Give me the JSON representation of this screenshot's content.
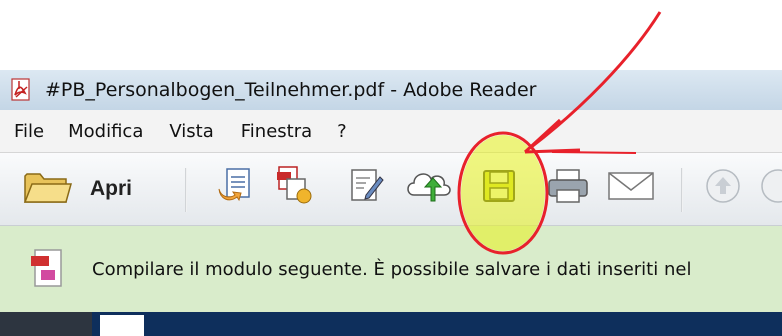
{
  "window": {
    "title": "#PB_Personalbogen_Teilnehmer.pdf - Adobe Reader"
  },
  "menu": {
    "items": [
      "File",
      "Modifica",
      "Vista",
      "Finestra",
      "?"
    ]
  },
  "toolbar": {
    "open_label": "Apri",
    "buttons": [
      {
        "name": "open-folder-icon"
      },
      {
        "name": "export-document-icon"
      },
      {
        "name": "create-pdf-icon"
      },
      {
        "name": "edit-document-icon"
      },
      {
        "name": "upload-cloud-icon"
      },
      {
        "name": "save-icon"
      },
      {
        "name": "print-icon"
      },
      {
        "name": "email-icon"
      },
      {
        "name": "page-up-icon"
      }
    ]
  },
  "infobar": {
    "message": "Compilare il modulo seguente. È possibile salvare i dati inseriti nel"
  },
  "colors": {
    "annotation_red": "#e8212b",
    "highlight_yellow": "#e8f21a",
    "infobar_green": "#d9eccb",
    "document_navy": "#0e2f5c"
  }
}
